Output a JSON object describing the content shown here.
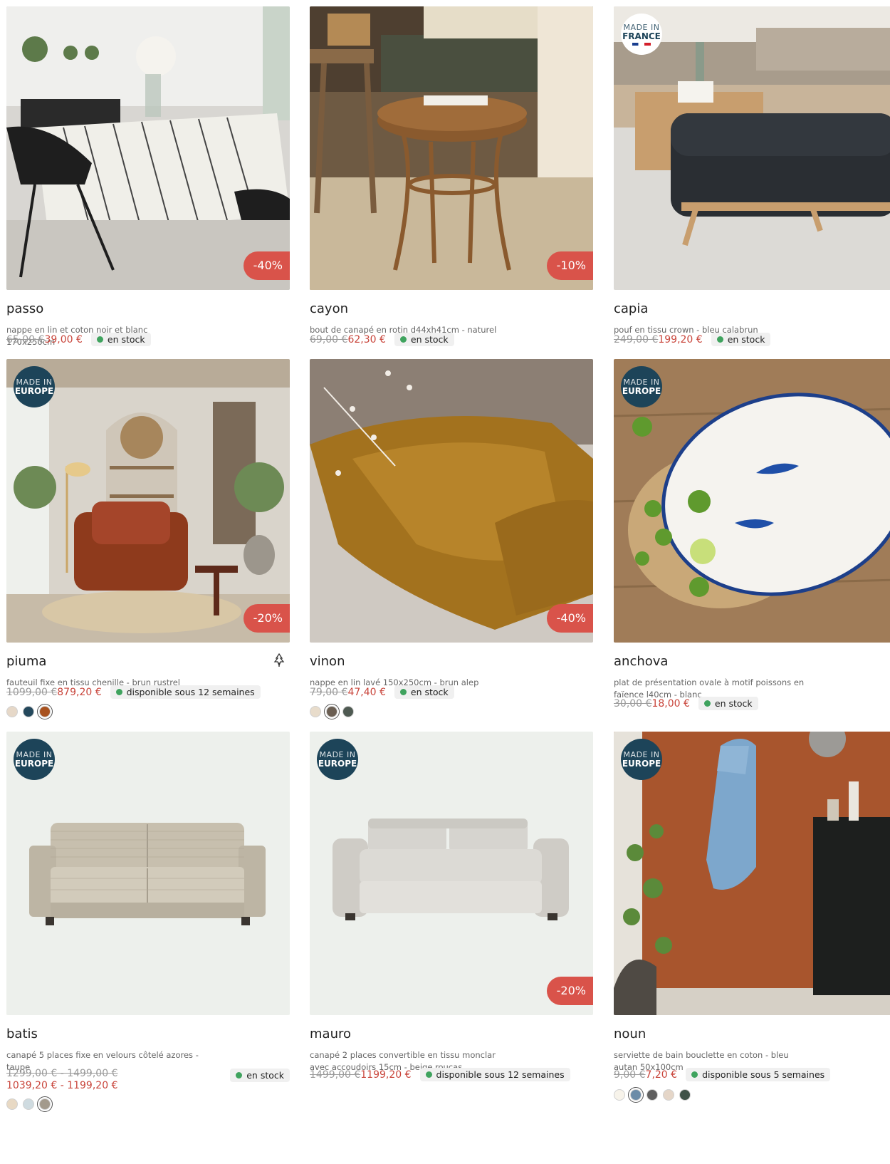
{
  "products": [
    {
      "name": "passo",
      "description": "nappe en lin et coton noir et blanc 170x250cm",
      "old_price": "65,00 €",
      "price": "39,00 €",
      "stock": "en stock",
      "discount": "-40%",
      "origin": null
    },
    {
      "name": "cayon",
      "description": "bout de canapé en rotin d44xh41cm - naturel",
      "old_price": "69,00 €",
      "price": "62,30 €",
      "stock": "en stock",
      "discount": "-10%",
      "origin": null
    },
    {
      "name": "capia",
      "description": "pouf en tissu crown - bleu calabrun",
      "old_price": "249,00 €",
      "price": "199,20 €",
      "stock": "en stock",
      "discount": "",
      "origin": {
        "line1": "MADE IN",
        "line2": "FRANCE"
      }
    },
    {
      "name": "piuma",
      "description": "fauteuil fixe en tissu chenille - brun rustrel",
      "old_price": "1099,00 €",
      "price": "879,20 €",
      "stock": "disponible sous 12 semaines",
      "discount": "-20%",
      "origin": {
        "line1": "MADE IN",
        "line2": "EUROPE"
      },
      "swatches": [
        "#e6d8c8",
        "#24485c",
        "#a8521f"
      ]
    },
    {
      "name": "vinon",
      "description": "nappe en lin lavé 150x250cm - brun alep",
      "old_price": "79,00 €",
      "price": "47,40 €",
      "stock": "en stock",
      "discount": "-40%",
      "origin": null,
      "swatches": [
        "#e8dccb",
        "#6a5e52",
        "#4f5a52"
      ]
    },
    {
      "name": "anchova",
      "description": "plat de présentation ovale à motif poissons en faïence l40cm - blanc",
      "old_price": "30,00 €",
      "price": "18,00 €",
      "stock": "en stock",
      "discount": "",
      "origin": {
        "line1": "MADE IN",
        "line2": "EUROPE"
      }
    },
    {
      "name": "batis",
      "description": "canapé 5 places fixe en velours côtelé azores - taupe",
      "old_price": "1299,00 € - 1499,00 €",
      "price": "1039,20 € - 1199,20 €",
      "stock": "en stock",
      "discount": "",
      "origin": {
        "line1": "MADE IN",
        "line2": "EUROPE"
      },
      "swatches": [
        "#e8d9c4",
        "#cfdbe0",
        "#a39a8c"
      ]
    },
    {
      "name": "mauro",
      "description": "canapé 2 places convertible en tissu monclar avec accoudoirs 15cm - beige roucas",
      "old_price": "1499,00 €",
      "price": "1199,20 €",
      "stock": "disponible sous 12 semaines",
      "discount": "-20%",
      "origin": {
        "line1": "MADE IN",
        "line2": "EUROPE"
      }
    },
    {
      "name": "noun",
      "description": "serviette de bain bouclette en coton - bleu autan 50x100cm",
      "old_price": "9,00 €",
      "price": "7,20 €",
      "stock": "disponible sous 5 semaines",
      "discount": "",
      "origin": {
        "line1": "MADE IN",
        "line2": "EUROPE"
      },
      "swatches": [
        "#f7f3ea",
        "#6c8ca8",
        "#5f5f5f",
        "#e5d6c8",
        "#3f5248"
      ]
    }
  ],
  "colors": {
    "accent": "#c9453b",
    "discount_bg": "#d9534a",
    "stock_dot": "#3fa35e",
    "badge_bg": "#1d4459"
  }
}
